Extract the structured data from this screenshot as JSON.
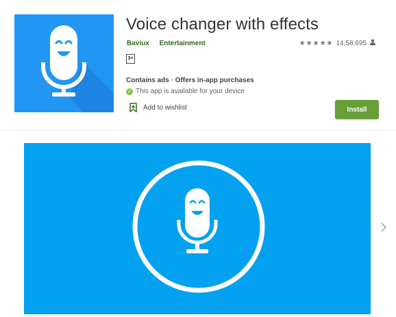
{
  "app": {
    "title": "Voice changer with effects",
    "developer": "Baviux",
    "category": "Entertainment",
    "rating_count": "14,58,695",
    "stars": "★★★★★",
    "content_rating": "3+",
    "ads_text": "Contains ads · Offers in-app purchases",
    "availability": "This app is available for your device",
    "wishlist_label": "Add to wishlist",
    "install_label": "Install",
    "availability_icon": "✓"
  },
  "icons": {
    "app_icon": "microphone-face-icon",
    "wishlist": "bookmark-plus-icon",
    "user": "person-icon",
    "next": "chevron-right-icon"
  },
  "colors": {
    "icon_bg": "#2196f3",
    "screenshot_bg": "#03a1ef",
    "install_bg": "#689f38",
    "brand_text": "#33691e"
  }
}
